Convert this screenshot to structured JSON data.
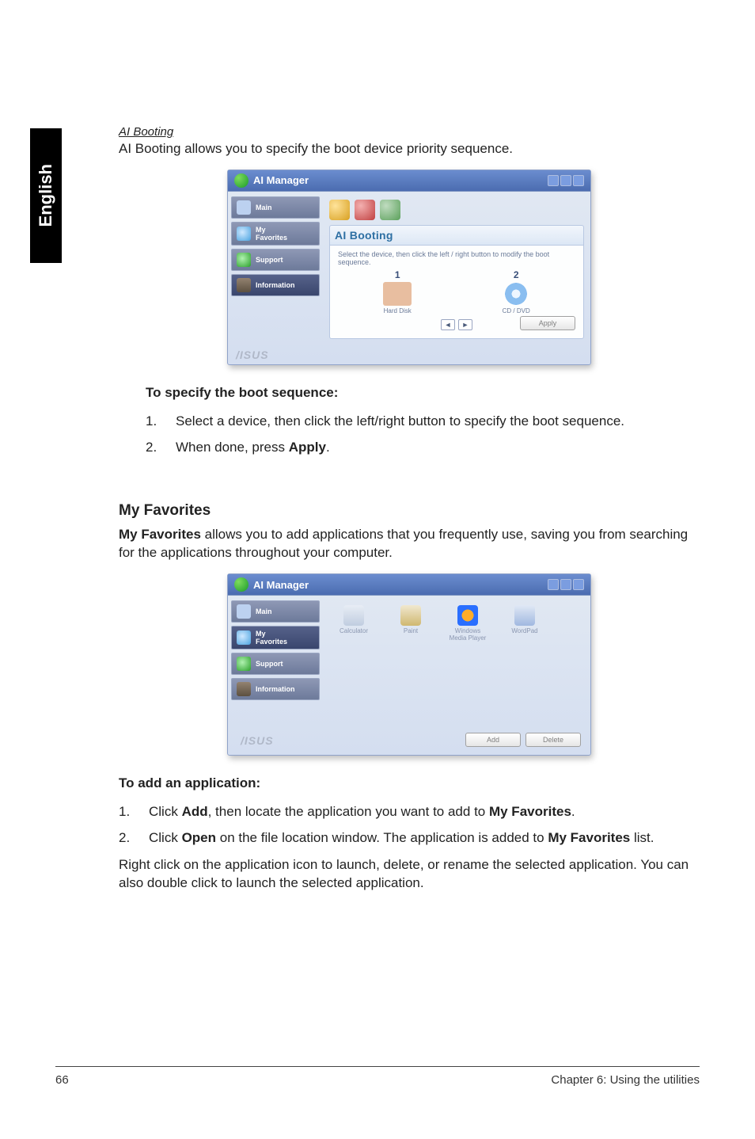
{
  "side_tab": "English",
  "section1": {
    "heading": "AI Booting",
    "intro": "AI Booting allows you to specify the boot device priority sequence.",
    "screenshot": {
      "window_title": "AI Manager",
      "sidebar": [
        {
          "label": "Main"
        },
        {
          "label": "My\nFavorites"
        },
        {
          "label": "Support"
        },
        {
          "label": "Information"
        }
      ],
      "panel_title": "AI Booting",
      "hint": "Select the device, then click the left / right button to modify the boot sequence.",
      "device1_num": "1",
      "device1_label": "Hard Disk",
      "device2_num": "2",
      "device2_label": "CD / DVD",
      "arrow_left": "◄",
      "arrow_right": "►",
      "apply_btn": "Apply",
      "brand": "/ISUS"
    },
    "subhead": "To specify the boot sequence:",
    "steps": [
      {
        "n": "1.",
        "text_pre": "Select a device, then click the left/right button to specify the boot sequence."
      },
      {
        "n": "2.",
        "text_pre": "When done, press ",
        "bold": "Apply",
        "text_post": "."
      }
    ]
  },
  "section2": {
    "heading": "My Favorites",
    "intro_bold": "My Favorites",
    "intro_rest": " allows you to add applications that you frequently use, saving you from searching for the applications throughout your computer.",
    "screenshot": {
      "window_title": "AI Manager",
      "sidebar": [
        {
          "label": "Main"
        },
        {
          "label": "My\nFavorites"
        },
        {
          "label": "Support"
        },
        {
          "label": "Information"
        }
      ],
      "apps": [
        {
          "label": "Calculator"
        },
        {
          "label": "Paint"
        },
        {
          "label": "Windows\nMedia Player"
        },
        {
          "label": "WordPad"
        }
      ],
      "add_btn": "Add",
      "delete_btn": "Delete",
      "brand": "/ISUS"
    },
    "subhead": "To add an application:",
    "steps": [
      {
        "n": "1.",
        "pre": "Click ",
        "b1": "Add",
        "mid": ", then locate the application you want to add to ",
        "b2": "My Favorites",
        "post": "."
      },
      {
        "n": "2.",
        "pre": "Click ",
        "b1": "Open",
        "mid": " on the file location window. The application is added to ",
        "b2": "My Favorites",
        "post": " list."
      }
    ],
    "closing": "Right click on the application icon to launch, delete, or rename the selected application. You can also double click to launch the selected application."
  },
  "footer": {
    "page": "66",
    "chapter": "Chapter 6: Using the utilities"
  }
}
